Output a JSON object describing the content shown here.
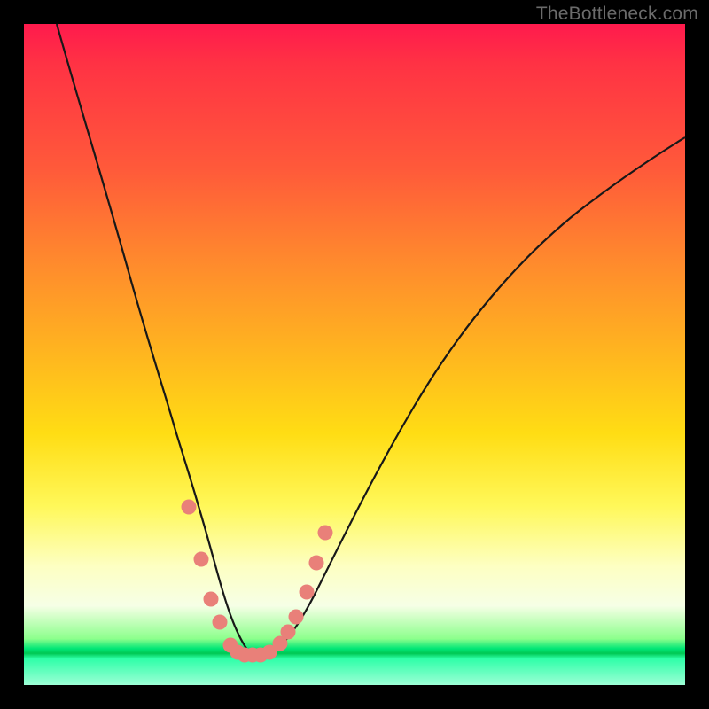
{
  "watermark": "TheBottleneck.com",
  "colors": {
    "frame": "#000000",
    "curve_stroke": "#181818",
    "marker_fill": "#e98079",
    "gradient_top": "#ff1a4d",
    "gradient_bottom": "#9dffd6"
  },
  "chart_data": {
    "type": "line",
    "title": "",
    "xlabel": "",
    "ylabel": "",
    "xlim": [
      0,
      100
    ],
    "ylim": [
      0,
      100
    ],
    "note": "No axes or tick labels are rendered; values are relative estimates in a 0–100 coordinate space (origin at bottom-left of the colored plot area).",
    "series": [
      {
        "name": "bottleneck-curve",
        "x": [
          5,
          8,
          12,
          16,
          19,
          22,
          24.5,
          27,
          29,
          31,
          33,
          34.5,
          36,
          38,
          41,
          44,
          48,
          53,
          59,
          66,
          74,
          83,
          92,
          100
        ],
        "y": [
          100,
          89,
          76,
          62,
          50,
          38,
          28,
          18,
          11,
          6.5,
          4.8,
          4.5,
          4.6,
          5.3,
          8,
          14,
          22,
          32,
          42,
          52,
          61,
          69,
          75.5,
          80
        ]
      }
    ],
    "markers": {
      "name": "highlight-points",
      "x": [
        25.0,
        26.8,
        28.3,
        29.6,
        31.2,
        32.3,
        33.4,
        34.6,
        35.8,
        37.2,
        38.8,
        39.9,
        41.2,
        42.8,
        44.3,
        45.6
      ],
      "y": [
        27.0,
        19.0,
        13.0,
        9.5,
        6.0,
        5.0,
        4.6,
        4.5,
        4.6,
        5.0,
        6.3,
        8.0,
        10.3,
        14.0,
        18.5,
        23.0
      ]
    }
  }
}
